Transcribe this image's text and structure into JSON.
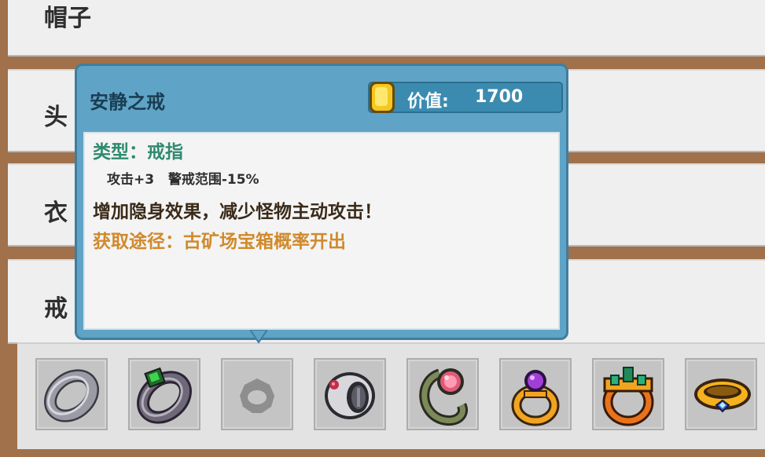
{
  "categories": [
    {
      "label": "帽子"
    },
    {
      "label": "头"
    },
    {
      "label": "衣"
    },
    {
      "label": "戒"
    }
  ],
  "tooltip": {
    "name": "安静之戒",
    "value_label": "价值:",
    "value": "1700",
    "type_line": "类型：戒指",
    "stats": "攻击+3   警戒范围-15%",
    "description": "增加隐身效果，减少怪物主动攻击！",
    "source": "获取途径：古矿场宝箱概率开出"
  },
  "ring_slots": [
    {
      "icon": "silver-ring-icon"
    },
    {
      "icon": "emerald-dark-ring-icon"
    },
    {
      "icon": "ring-silhouette-icon"
    },
    {
      "icon": "ruby-silver-ring-icon"
    },
    {
      "icon": "pink-gem-vine-ring-icon"
    },
    {
      "icon": "amethyst-gold-ring-icon"
    },
    {
      "icon": "emerald-crown-ring-icon"
    },
    {
      "icon": "diamond-gold-band-icon"
    }
  ],
  "colors": {
    "frame": "#a0714b",
    "tooltip_bg": "#5fa3c6",
    "type_text": "#2f8a6f",
    "source_text": "#d08a2c"
  }
}
